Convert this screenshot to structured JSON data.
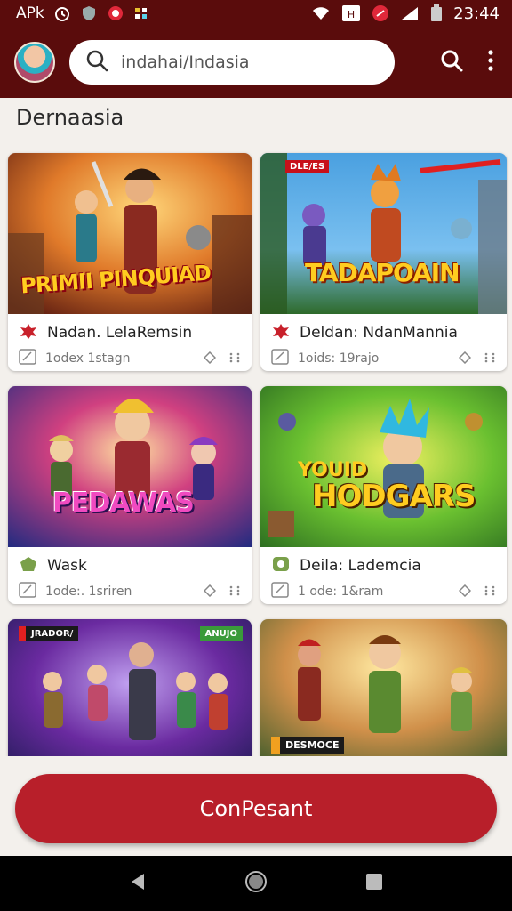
{
  "status_bar": {
    "carrier": "APk",
    "time": "23:44",
    "icons": [
      "alarm-icon",
      "shield-icon",
      "record-icon",
      "dots-icon",
      "wifi-icon",
      "hd-icon",
      "data-icon",
      "signal-icon",
      "battery-icon"
    ]
  },
  "app_bar": {
    "search_text": "indahai/Indasia",
    "icons": [
      "search-icon",
      "more-vert-icon"
    ]
  },
  "section": {
    "title": "Dernaasia"
  },
  "cards": [
    {
      "title": "Nadan. LelaRemsin",
      "meta": "1odex 1stagn",
      "banner": "PRIMII PINQUIAD",
      "bg_colors": [
        "#f0a43a",
        "#7a2a1a"
      ]
    },
    {
      "title": "Deldan: NdanMannia",
      "meta": "1oids: 19rajo",
      "badge": "DLE/ES",
      "banner": "TADAPOAIN",
      "bg_colors": [
        "#3a8ad0",
        "#2e7a3a"
      ]
    },
    {
      "title": "Wask",
      "meta": "1ode:. 1sriren",
      "banner": "PEDAWAS",
      "bg_colors": [
        "#2a3ea8",
        "#a8204a"
      ]
    },
    {
      "title": "Deila: Lademcia",
      "meta": "1 ode: 1&ram",
      "banner_line1": "YOUID",
      "banner_line2": "HODGARS",
      "bg_colors": [
        "#5aa830",
        "#d0e040"
      ]
    },
    {
      "badge_left": "JRADOR/",
      "badge_right": "ANUJO",
      "bg_colors": [
        "#6a2aa0",
        "#2a3a90"
      ]
    },
    {
      "badge": "DESMOCE",
      "bg_colors": [
        "#e0a84a",
        "#3a6a30"
      ]
    }
  ],
  "cta": {
    "label": "ConPesant"
  },
  "colors": {
    "header_bg": "#5a0c0c",
    "accent": "#b81f2a",
    "page_bg": "#f3f0ec"
  }
}
